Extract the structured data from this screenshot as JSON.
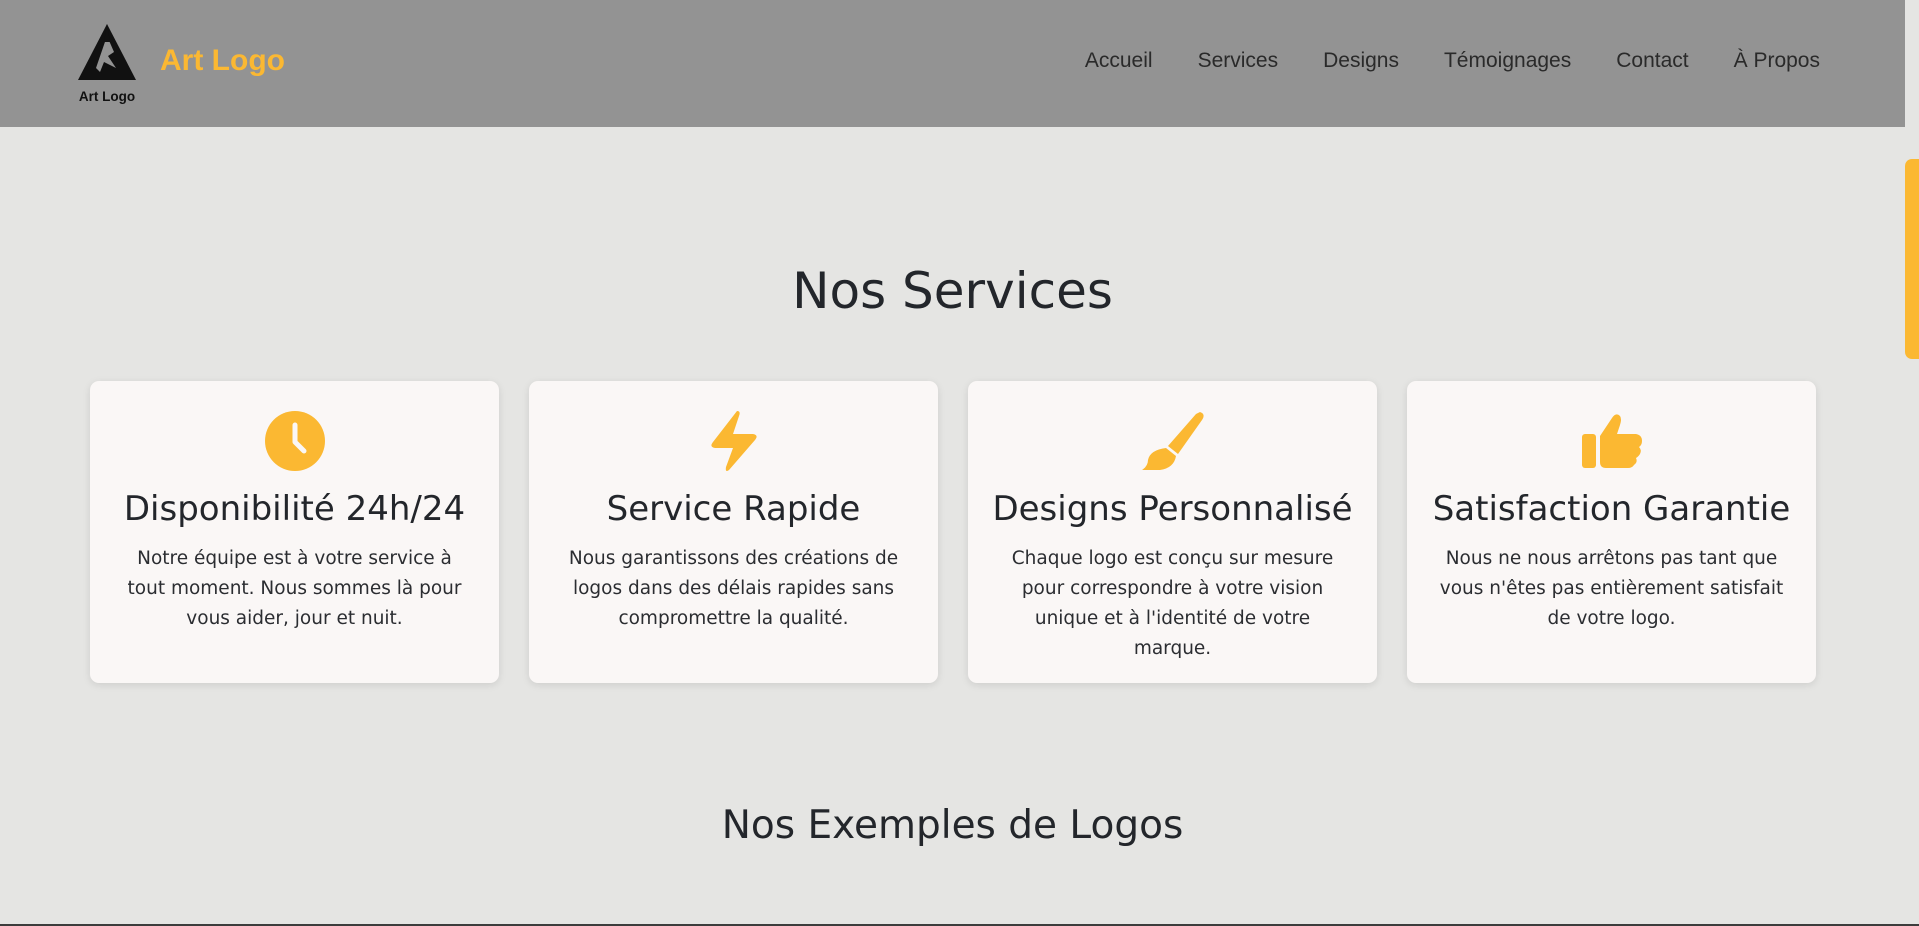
{
  "header": {
    "logo_caption": "Art Logo",
    "brand": "Art Logo",
    "nav": [
      "Accueil",
      "Services",
      "Designs",
      "Témoignages",
      "Contact",
      "À Propos"
    ]
  },
  "accent_color": "#fbb832",
  "services": {
    "title": "Nos Services",
    "cards": [
      {
        "icon": "clock-icon",
        "title": "Disponibilité 24h/24",
        "text": "Notre équipe est à votre service à tout moment. Nous sommes là pour vous aider, jour et nuit."
      },
      {
        "icon": "bolt-icon",
        "title": "Service Rapide",
        "text": "Nous garantissons des créations de logos dans des délais rapides sans compromettre la qualité."
      },
      {
        "icon": "paintbrush-icon",
        "title": "Designs Personnalisé",
        "text": "Chaque logo est conçu sur mesure pour correspondre à votre vision unique et à l'identité de votre marque."
      },
      {
        "icon": "thumbs-up-icon",
        "title": "Satisfaction Garantie",
        "text": "Nous ne nous arrêtons pas tant que vous n'êtes pas entièrement satisfait de votre logo."
      }
    ]
  },
  "examples": {
    "title": "Nos Exemples de Logos"
  }
}
